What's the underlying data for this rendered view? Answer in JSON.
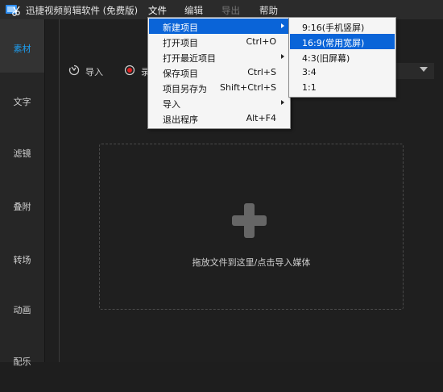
{
  "app": {
    "title": "迅捷视频剪辑软件 (免费版)"
  },
  "menubar": {
    "file": "文件",
    "edit": "编辑",
    "export": "导出",
    "help": "帮助"
  },
  "sidebar": {
    "items": [
      {
        "label": "素材"
      },
      {
        "label": "文字"
      },
      {
        "label": "滤镜"
      },
      {
        "label": "叠附"
      },
      {
        "label": "转场"
      },
      {
        "label": "动画"
      },
      {
        "label": "配乐"
      }
    ]
  },
  "toolbar": {
    "import_label": "导入",
    "record_label": "录"
  },
  "dropzone": {
    "hint": "拖放文件到这里/点击导入媒体"
  },
  "file_menu": {
    "items": [
      {
        "label": "新建项目",
        "shortcut": ""
      },
      {
        "label": "打开项目",
        "shortcut": "Ctrl+O"
      },
      {
        "label": "打开最近项目",
        "shortcut": ""
      },
      {
        "label": "保存项目",
        "shortcut": "Ctrl+S"
      },
      {
        "label": "项目另存为",
        "shortcut": "Shift+Ctrl+S"
      },
      {
        "label": "导入",
        "shortcut": ""
      },
      {
        "label": "退出程序",
        "shortcut": "Alt+F4"
      }
    ]
  },
  "new_project_submenu": {
    "items": [
      {
        "label": "9:16(手机竖屏)"
      },
      {
        "label": "16:9(常用宽屏)"
      },
      {
        "label": "4:3(旧屏幕)"
      },
      {
        "label": "3:4"
      },
      {
        "label": "1:1"
      }
    ]
  },
  "colors": {
    "accent": "#1e9ef0",
    "menu_highlight": "#0a64d8",
    "background": "#1e1e1e"
  }
}
